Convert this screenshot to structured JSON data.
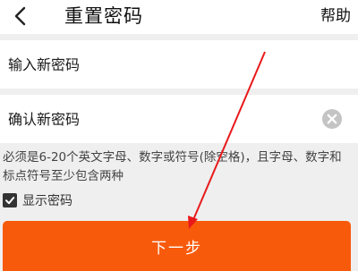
{
  "header": {
    "back_icon": "chevron-left-icon",
    "title": "重置密码",
    "help_label": "帮助"
  },
  "form": {
    "new_password_placeholder": "输入新密码",
    "confirm_password_placeholder": "确认新密码",
    "clear_icon": "clear-circle-icon",
    "hint": "必须是6-20个英文字母、数字或符号(除空格)，且字母、数字和标点符号至少包含两种",
    "show_password_label": "显示密码",
    "show_password_checked": true,
    "next_button_label": "下一步"
  },
  "colors": {
    "primary": "#f85a0c",
    "annotation_arrow": "#e8191b",
    "background": "#efefef"
  }
}
